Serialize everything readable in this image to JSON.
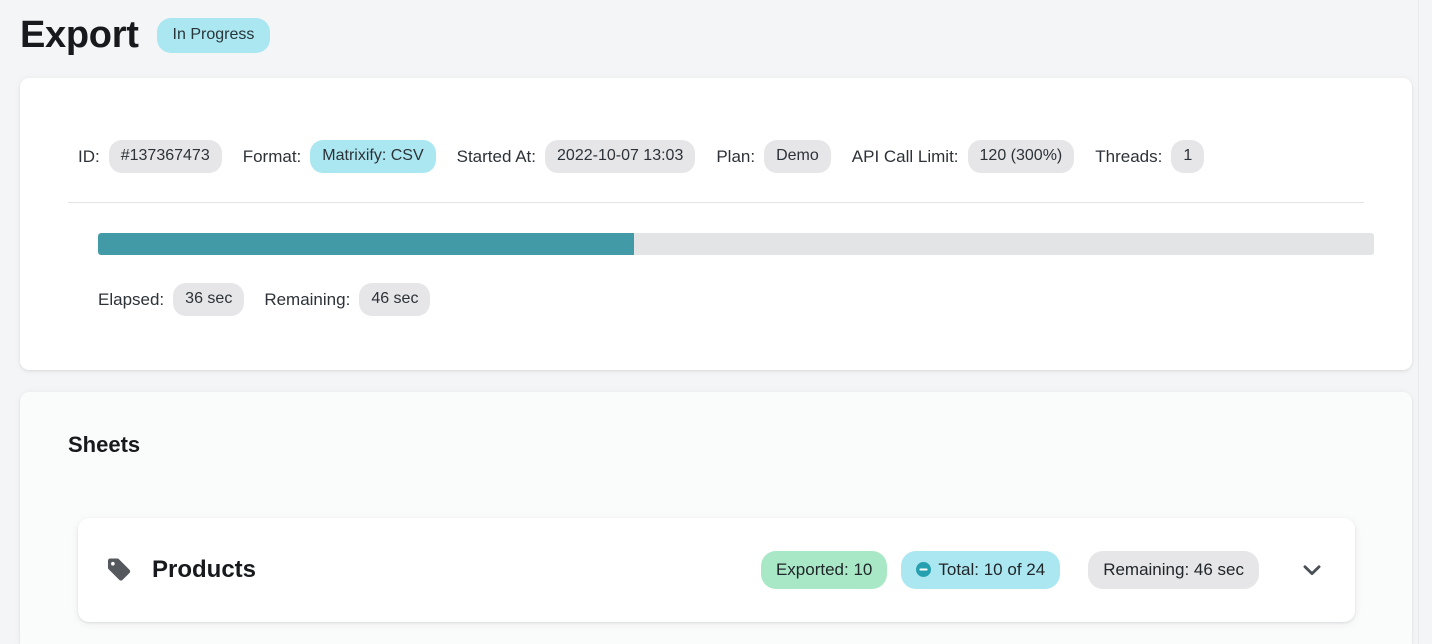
{
  "header": {
    "title": "Export",
    "status": "In Progress"
  },
  "summary": {
    "meta": [
      {
        "label": "ID:",
        "value": "#137367473",
        "style": "gray"
      },
      {
        "label": "Format:",
        "value": "Matrixify: CSV",
        "style": "cyan"
      },
      {
        "label": "Started At:",
        "value": "2022-10-07 13:03",
        "style": "gray"
      },
      {
        "label": "Plan:",
        "value": "Demo",
        "style": "gray"
      },
      {
        "label": "API Call Limit:",
        "value": "120 (300%)",
        "style": "gray"
      },
      {
        "label": "Threads:",
        "value": "1",
        "style": "gray"
      }
    ],
    "progress": {
      "percent": 42,
      "fill_color": "#419aa5",
      "track_color": "#e3e4e6"
    },
    "timing": [
      {
        "label": "Elapsed:",
        "value": "36 sec"
      },
      {
        "label": "Remaining:",
        "value": "46 sec"
      }
    ]
  },
  "sheets": {
    "title": "Sheets",
    "items": [
      {
        "icon": "tag-icon",
        "name": "Products",
        "exported_badge": "Exported: 10",
        "total_badge": "Total: 10 of 24",
        "total_badge_icon": "minus-circle-icon",
        "remaining_badge": "Remaining: 46 sec",
        "expand_icon": "chevron-down-icon"
      }
    ]
  },
  "colors": {
    "page_background": "#f4f5f7",
    "accent_teal": "#419aa5",
    "badge_cyan": "#abe7f0",
    "badge_green": "#a9e8c6",
    "badge_gray": "#e6e6e8"
  }
}
